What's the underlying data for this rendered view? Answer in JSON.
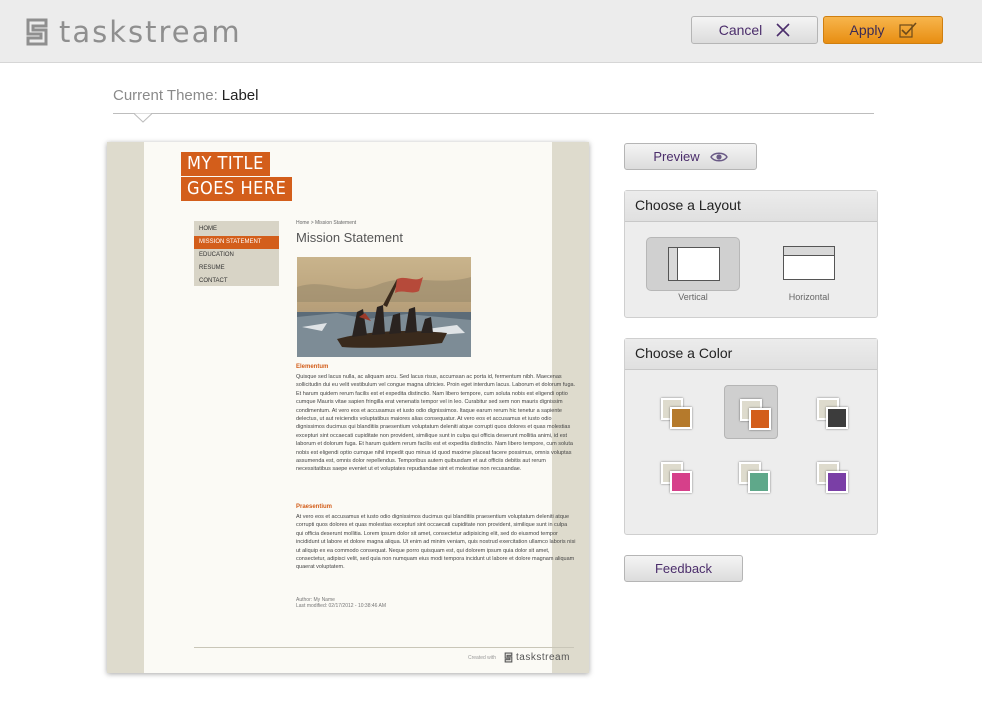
{
  "header": {
    "logo_text": "taskstream",
    "cancel_label": "Cancel",
    "apply_label": "Apply"
  },
  "theme": {
    "key": "Current Theme:",
    "value": "Label"
  },
  "preview_site": {
    "title_line1": "MY TITLE",
    "title_line2": "GOES HERE",
    "nav": [
      "HOME",
      "MISSION STATEMENT",
      "EDUCATION",
      "RESUME",
      "CONTACT"
    ],
    "nav_active": "MISSION STATEMENT",
    "breadcrumb": "Home > Mission Statement",
    "heading": "Mission Statement",
    "section1_title": "Elementum",
    "section1_text": "Quisque sed lacus nulla, ac aliquam arcu. Sed lacus risus, accumsan ac porta id, fermentum nibh. Maecenas sollicitudin dui eu velit vestibulum vel congue magna ultricies. Proin eget interdum lacus. Laborum et dolorum fuga. Et harum quidem rerum facilis est et expedita distinctio. Nam libero tempore, cum soluta nobis est eligendi optio cumque Mauris vitae sapien fringilla erat venenatis tempor vel in leo. Curabitur sed sem non mauris dignissim condimentum. At vero eos et accusamus et iusto odio dignissimos. Itaque earum rerum hic tenetur a sapiente delectus, ut aut reiciendis voluptatibus maiores alias consequatur. At vero eos et accusamus et iusto odio dignissimos ducimus qui blanditiis praesentium voluptatum deleniti atque corrupti quos dolores et quas molestias excepturi sint occaecati cupiditate non provident, similique sunt in culpa qui officia deserunt mollitia animi, id est laborum et dolorum fuga. Et harum quidem rerum facilis est et expedita distinctio. Nam libero tempore, cum soluta nobis est eligendi optio cumque nihil impedit quo minus id quod maxime placeat facere possimus, omnis voluptas assumenda est, omnis dolor repellendus. Temporibus autem quibusdam et aut officiis debitis aut rerum necessitatibus saepe eveniet ut et voluptates repudiandae sint et molestiae non recusandae.",
    "section2_title": "Praesentium",
    "section2_text": "At vero eos et accusamus et iusto odio dignissimos ducimus qui blanditiis praesentium voluptatum deleniti atque corrupti quos dolores et quas molestias excepturi sint occaecati cupiditate non provident, similique sunt in culpa qui officia deserunt mollitia. Lorem ipsum dolor sit amet, consectetur adipisicing elit, sed do eiusmod tempor incididunt ut labore et dolore magna aliqua. Ut enim ad minim veniam, quis nostrud exercitation ullamco laboris nisi ut aliquip ex ea commodo consequat. Neque porro quisquam est, qui dolorem ipsum quia dolor sit amet, consectetur, adipisci velit, sed quia non numquam eius modi tempora incidunt ut labore et dolore magnam aliquam quaerat voluptatem.",
    "author": "Author: My Name",
    "modified": "Last modified: 02/17/2012 - 10:38:46 AM",
    "created_with": "Created with",
    "footer_logo": "taskstream"
  },
  "controls": {
    "preview_label": "Preview",
    "layout_title": "Choose a Layout",
    "layouts": [
      {
        "label": "Vertical",
        "selected": true
      },
      {
        "label": "Horizontal",
        "selected": false
      }
    ],
    "color_title": "Choose a Color",
    "colors": [
      {
        "back": "#dedbcd",
        "front": "#b57a2c",
        "selected": false
      },
      {
        "back": "#dedbcd",
        "front": "#d35e1b",
        "selected": true
      },
      {
        "back": "#dedbcd",
        "front": "#3c3c3c",
        "selected": false
      },
      {
        "back": "#dedbcd",
        "front": "#d6408a",
        "selected": false
      },
      {
        "back": "#dedbcd",
        "front": "#5fa88a",
        "selected": false
      },
      {
        "back": "#dedbcd",
        "front": "#7a3fa6",
        "selected": false
      }
    ],
    "feedback_label": "Feedback"
  }
}
